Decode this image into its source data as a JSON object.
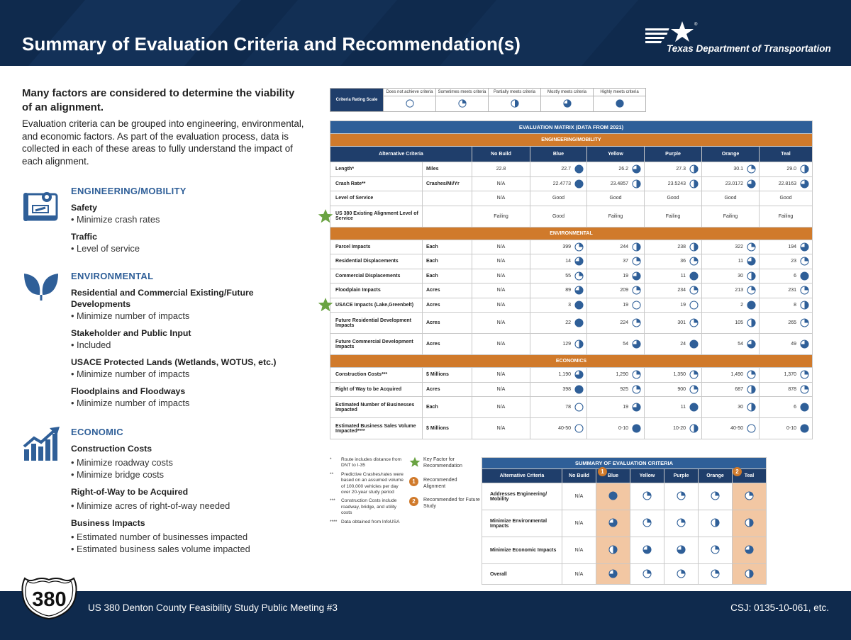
{
  "header": {
    "title": "Summary of Evaluation Criteria and Recommendation(s)",
    "org_name": "Texas Department of Transportation"
  },
  "left": {
    "lead": "Many factors are considered to determine the viability of an alignment.",
    "intro": "Evaluation criteria can be grouped into engineering, environmental, and economic factors. As part of the evaluation process, data is collected in each of these areas to fully understand the impact of each alignment.",
    "engineering": {
      "title": "ENGINEERING/MOBILITY",
      "items": [
        {
          "heading": "Safety",
          "bullets": [
            "• Minimize crash rates"
          ]
        },
        {
          "heading": "Traffic",
          "bullets": [
            "• Level of service"
          ]
        }
      ]
    },
    "environmental": {
      "title": "ENVIRONMENTAL",
      "items": [
        {
          "heading": "Residential and Commercial Existing/Future Developments",
          "bullets": [
            "• Minimize number of impacts"
          ]
        },
        {
          "heading": "Stakeholder and Public Input",
          "bullets": [
            "• Included"
          ]
        },
        {
          "heading": "USACE Protected Lands (Wetlands, WOTUS, etc.)",
          "bullets": [
            "• Minimize number of impacts"
          ]
        },
        {
          "heading": "Floodplains and Floodways",
          "bullets": [
            "• Minimize number of impacts"
          ]
        }
      ]
    },
    "economic": {
      "title": "ECONOMIC",
      "items": [
        {
          "heading": "Construction Costs",
          "bullets": [
            "• Minimize roadway costs",
            "• Minimize bridge costs"
          ]
        },
        {
          "heading": "Right-of-Way to be Acquired",
          "bullets": [
            "• Minimize acres of right-of-way needed"
          ]
        },
        {
          "heading": "Business Impacts",
          "bullets": [
            "• Estimated number of businesses impacted",
            "• Estimated business sales volume impacted"
          ]
        }
      ]
    }
  },
  "scale": {
    "label": "Criteria Rating Scale",
    "levels": [
      {
        "caption": "Does not achieve criteria",
        "fill": 0
      },
      {
        "caption": "Sometimes meets criteria",
        "fill": 0.25
      },
      {
        "caption": "Partially meets criteria",
        "fill": 0.5
      },
      {
        "caption": "Mostly meets criteria",
        "fill": 0.75
      },
      {
        "caption": "Highly meets criteria",
        "fill": 1
      }
    ]
  },
  "matrix": {
    "title": "EVALUATION MATRIX (DATA FROM 2021)",
    "headers": [
      "Alternative Criteria",
      "No Build",
      "Blue",
      "Yellow",
      "Purple",
      "Orange",
      "Teal"
    ],
    "sections": [
      {
        "name": "ENGINEERING/MOBILITY",
        "rows": [
          {
            "criterion": "Length*",
            "unit": "Miles",
            "no_build": "22.8",
            "key": false,
            "tall": false,
            "cells": [
              [
                "22.7",
                1
              ],
              [
                "26.2",
                0.75
              ],
              [
                "27.3",
                0.5
              ],
              [
                "30.1",
                0.25
              ],
              [
                "29.0",
                0.5
              ]
            ]
          },
          {
            "criterion": "Crash Rate**",
            "unit": "Crashes/Mi/Yr",
            "no_build": "N/A",
            "key": false,
            "tall": false,
            "cells": [
              [
                "22.4773",
                1
              ],
              [
                "23.4857",
                0.5
              ],
              [
                "23.5243",
                0.5
              ],
              [
                "23.0172",
                0.75
              ],
              [
                "22.8163",
                0.75
              ]
            ]
          },
          {
            "criterion": "Level of Service",
            "unit": "",
            "no_build": "N/A",
            "key": false,
            "tall": false,
            "cells": [
              [
                "Good",
                null
              ],
              [
                "Good",
                null
              ],
              [
                "Good",
                null
              ],
              [
                "Good",
                null
              ],
              [
                "Good",
                null
              ]
            ]
          },
          {
            "criterion": "US 380 Existing Alignment Level of Service",
            "unit": "",
            "no_build": "Failing",
            "key": true,
            "tall": true,
            "cells": [
              [
                "Good",
                null
              ],
              [
                "Failing",
                null
              ],
              [
                "Failing",
                null
              ],
              [
                "Failing",
                null
              ],
              [
                "Failing",
                null
              ]
            ]
          }
        ]
      },
      {
        "name": "ENVIRONMENTAL",
        "rows": [
          {
            "criterion": "Parcel Impacts",
            "unit": "Each",
            "no_build": "N/A",
            "key": false,
            "tall": false,
            "cells": [
              [
                "399",
                0.25
              ],
              [
                "244",
                0.5
              ],
              [
                "238",
                0.5
              ],
              [
                "322",
                0.25
              ],
              [
                "194",
                0.75
              ]
            ]
          },
          {
            "criterion": "Residential Displacements",
            "unit": "Each",
            "no_build": "N/A",
            "key": false,
            "tall": false,
            "cells": [
              [
                "14",
                0.75
              ],
              [
                "37",
                0.25
              ],
              [
                "36",
                0.25
              ],
              [
                "11",
                0.75
              ],
              [
                "23",
                0.25
              ]
            ]
          },
          {
            "criterion": "Commercial Displacements",
            "unit": "Each",
            "no_build": "N/A",
            "key": false,
            "tall": false,
            "cells": [
              [
                "55",
                0.25
              ],
              [
                "19",
                0.75
              ],
              [
                "11",
                1
              ],
              [
                "30",
                0.5
              ],
              [
                "6",
                1
              ]
            ]
          },
          {
            "criterion": "Floodplain Impacts",
            "unit": "Acres",
            "no_build": "N/A",
            "key": false,
            "tall": false,
            "cells": [
              [
                "89",
                0.75
              ],
              [
                "209",
                0.25
              ],
              [
                "234",
                0.25
              ],
              [
                "213",
                0.25
              ],
              [
                "231",
                0.25
              ]
            ]
          },
          {
            "criterion": "USACE Impacts (Lake,Greenbelt)",
            "unit": "Acres",
            "no_build": "N/A",
            "key": true,
            "tall": false,
            "cells": [
              [
                "3",
                1
              ],
              [
                "19",
                0
              ],
              [
                "19",
                0
              ],
              [
                "2",
                1
              ],
              [
                "8",
                0.5
              ]
            ]
          },
          {
            "criterion": "Future Residential Development Impacts",
            "unit": "Acres",
            "no_build": "N/A",
            "key": false,
            "tall": true,
            "cells": [
              [
                "22",
                1
              ],
              [
                "224",
                0.25
              ],
              [
                "301",
                0.25
              ],
              [
                "105",
                0.5
              ],
              [
                "265",
                0.25
              ]
            ]
          },
          {
            "criterion": "Future Commercial Development Impacts",
            "unit": "Acres",
            "no_build": "N/A",
            "key": false,
            "tall": true,
            "cells": [
              [
                "129",
                0.5
              ],
              [
                "54",
                0.75
              ],
              [
                "24",
                1
              ],
              [
                "54",
                0.75
              ],
              [
                "49",
                0.75
              ]
            ]
          }
        ]
      },
      {
        "name": "ECONOMICS",
        "rows": [
          {
            "criterion": "Construction Costs***",
            "unit": "$ Millions",
            "no_build": "N/A",
            "key": false,
            "tall": false,
            "cells": [
              [
                "1,190",
                0.75
              ],
              [
                "1,290",
                0.25
              ],
              [
                "1,350",
                0.25
              ],
              [
                "1,490",
                0.25
              ],
              [
                "1,370",
                0.25
              ]
            ]
          },
          {
            "criterion": "Right of Way to be Acquired",
            "unit": "Acres",
            "no_build": "N/A",
            "key": false,
            "tall": false,
            "cells": [
              [
                "398",
                1
              ],
              [
                "925",
                0.25
              ],
              [
                "900",
                0.25
              ],
              [
                "687",
                0.5
              ],
              [
                "878",
                0.25
              ]
            ]
          },
          {
            "criterion": "Estimated Number of Businesses Impacted",
            "unit": "Each",
            "no_build": "N/A",
            "key": false,
            "tall": true,
            "cells": [
              [
                "78",
                0
              ],
              [
                "19",
                0.75
              ],
              [
                "11",
                1
              ],
              [
                "30",
                0.5
              ],
              [
                "6",
                1
              ]
            ]
          },
          {
            "criterion": "Estimated Business Sales Volume Impacted****",
            "unit": "$ Millions",
            "no_build": "N/A",
            "key": false,
            "tall": true,
            "cells": [
              [
                "40-50",
                0
              ],
              [
                "0-10",
                1
              ],
              [
                "10-20",
                0.5
              ],
              [
                "40-50",
                0
              ],
              [
                "0-10",
                1
              ]
            ]
          }
        ]
      }
    ]
  },
  "footnotes": [
    {
      "mark": "*",
      "text": "Route includes distance from DNT to I-35"
    },
    {
      "mark": "**",
      "text": "Predictive Crashes/rates were based on an assumed volume of 100,000 vehicles per day over 20-year study period"
    },
    {
      "mark": "***",
      "text": "Construction Costs include roadway, bridge, and utility costs"
    },
    {
      "mark": "****",
      "text": "Data obtained from InfoUSA"
    }
  ],
  "legend": {
    "key_factor": "Key Factor for Recommendation",
    "recommended": "Recommended Alignment",
    "future": "Recommended for Future Study",
    "badge_1": "1",
    "badge_2": "2"
  },
  "summary": {
    "title": "SUMMARY OF EVALUATION CRITERIA",
    "headers": [
      "Alternative Criteria",
      "No Build",
      "Blue",
      "Yellow",
      "Purple",
      "Orange",
      "Teal"
    ],
    "rows": [
      {
        "criterion": "Addresses Engineering/ Mobility",
        "no_build": "N/A",
        "fills": [
          1,
          0.25,
          0.25,
          0.25,
          0.25
        ]
      },
      {
        "criterion": "Minimize Environmental Impacts",
        "no_build": "N/A",
        "fills": [
          0.75,
          0.25,
          0.25,
          0.5,
          0.5
        ]
      },
      {
        "criterion": "Minimize Economic Impacts",
        "no_build": "N/A",
        "fills": [
          0.5,
          0.75,
          0.75,
          0.25,
          0.75
        ]
      },
      {
        "criterion": "Overall",
        "no_build": "N/A",
        "fills": [
          0.75,
          0.25,
          0.25,
          0.25,
          0.5
        ]
      }
    ]
  },
  "footer": {
    "shield_number": "380",
    "meeting": "US 380 Denton County Feasibility Study Public Meeting #3",
    "csj": "CSJ: 0135-10-061, etc."
  },
  "colors": {
    "navy": "#0f2a4d",
    "blue": "#2f5f98",
    "dark_blue": "#1f3e6b",
    "orange": "#d07a2b",
    "highlight": "#f2c7a3",
    "star_green": "#6aa342"
  }
}
